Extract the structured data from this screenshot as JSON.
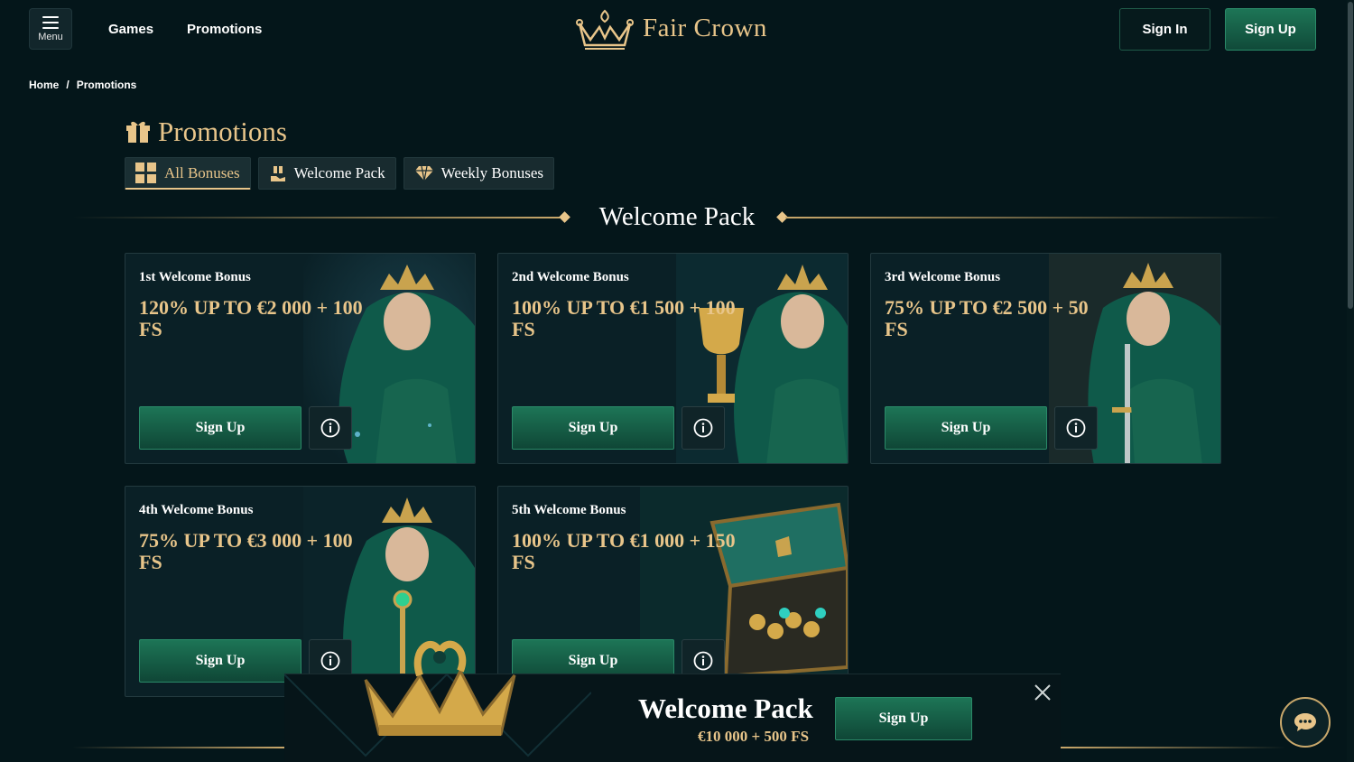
{
  "header": {
    "menu_label": "Menu",
    "nav": [
      "Games",
      "Promotions"
    ],
    "logo_text": "Fair Crown",
    "sign_in": "Sign In",
    "sign_up": "Sign Up"
  },
  "breadcrumb": {
    "home": "Home",
    "separator": "/",
    "current": "Promotions"
  },
  "page": {
    "title": "Promotions",
    "tabs": [
      {
        "label": "All Bonuses",
        "icon": "grid-icon",
        "active": true
      },
      {
        "label": "Welcome Pack",
        "icon": "gift-hand-icon",
        "active": false
      },
      {
        "label": "Weekly Bonuses",
        "icon": "diamond-icon",
        "active": false
      }
    ],
    "section_title": "Welcome Pack"
  },
  "cards": [
    {
      "name": "1st Welcome Bonus",
      "offer": "120% UP TO €2 000 + 100 FS",
      "button": "Sign Up",
      "art": "elf-queen"
    },
    {
      "name": "2nd Welcome Bonus",
      "offer": "100% UP TO €1 500 + 100 FS",
      "button": "Sign Up",
      "art": "elf-queen-trophy"
    },
    {
      "name": "3rd Welcome Bonus",
      "offer": "75% UP TO €2 500 + 50 FS",
      "button": "Sign Up",
      "art": "elf-queen-sword"
    },
    {
      "name": "4th Welcome Bonus",
      "offer": "75% UP TO €3 000 + 100 FS",
      "button": "Sign Up",
      "art": "elf-queen-scepter"
    },
    {
      "name": "5th Welcome Bonus",
      "offer": "100% UP TO €1 000 + 150 FS",
      "button": "Sign Up",
      "art": "treasure-chest"
    }
  ],
  "banner": {
    "title": "Welcome Pack",
    "subtitle": "€10 000 + 500 FS",
    "button": "Sign Up"
  },
  "colors": {
    "background": "#04161a",
    "gold": "#e8c58a",
    "green_button": "#1d7556",
    "card_bg": "#0a2026"
  }
}
